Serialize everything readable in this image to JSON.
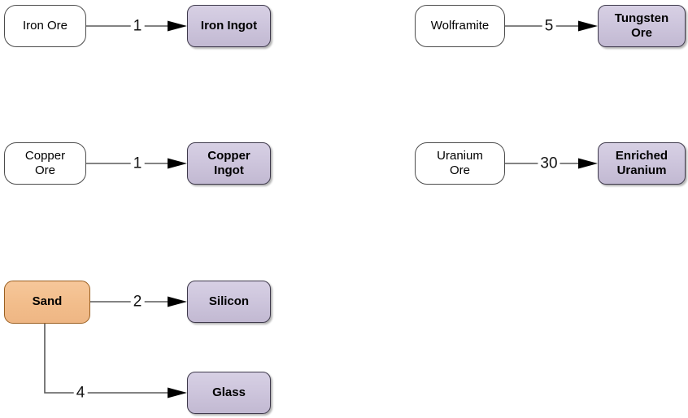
{
  "diagram": {
    "type": "production-recipe-flowchart",
    "colors": {
      "input_fill": "#FFFFFF",
      "input_border": "#4C4C4C",
      "source_fill": "#F2BD8B",
      "source_border": "#9A5F20",
      "output_fill": "#CEC6DD",
      "output_border": "#3F3A4C",
      "edge_stroke": "#5A5A5A",
      "arrowhead": "#000000",
      "text": "#000000",
      "background": "#FFFFFF"
    },
    "nodes": [
      {
        "id": "iron-ore",
        "label": "Iron Ore",
        "line1": "Iron Ore",
        "line2": "",
        "kind": "input"
      },
      {
        "id": "iron-ingot",
        "label": "Iron Ingot",
        "line1": "Iron Ingot",
        "line2": "",
        "kind": "output"
      },
      {
        "id": "copper-ore",
        "label": "Copper Ore",
        "line1": "Copper",
        "line2": "Ore",
        "kind": "input"
      },
      {
        "id": "copper-ingot",
        "label": "Copper Ingot",
        "line1": "Copper",
        "line2": "Ingot",
        "kind": "output"
      },
      {
        "id": "sand",
        "label": "Sand",
        "line1": "Sand",
        "line2": "",
        "kind": "source"
      },
      {
        "id": "silicon",
        "label": "Silicon",
        "line1": "Silicon",
        "line2": "",
        "kind": "output"
      },
      {
        "id": "glass",
        "label": "Glass",
        "line1": "Glass",
        "line2": "",
        "kind": "output"
      },
      {
        "id": "wolframite",
        "label": "Wolframite",
        "line1": "Wolframite",
        "line2": "",
        "kind": "input"
      },
      {
        "id": "tungsten-ore",
        "label": "Tungsten Ore",
        "line1": "Tungsten",
        "line2": "Ore",
        "kind": "output"
      },
      {
        "id": "uranium-ore",
        "label": "Uranium Ore",
        "line1": "Uranium",
        "line2": "Ore",
        "kind": "input"
      },
      {
        "id": "enriched-uranium",
        "label": "Enriched Uranium",
        "line1": "Enriched",
        "line2": "Uranium",
        "kind": "output"
      }
    ],
    "edges": [
      {
        "id": "e1",
        "from": "iron-ore",
        "to": "iron-ingot",
        "quantity": "1"
      },
      {
        "id": "e2",
        "from": "copper-ore",
        "to": "copper-ingot",
        "quantity": "1"
      },
      {
        "id": "e3",
        "from": "sand",
        "to": "silicon",
        "quantity": "2"
      },
      {
        "id": "e4",
        "from": "sand",
        "to": "glass",
        "quantity": "4"
      },
      {
        "id": "e5",
        "from": "wolframite",
        "to": "tungsten-ore",
        "quantity": "5"
      },
      {
        "id": "e6",
        "from": "uranium-ore",
        "to": "enriched-uranium",
        "quantity": "30"
      }
    ]
  }
}
